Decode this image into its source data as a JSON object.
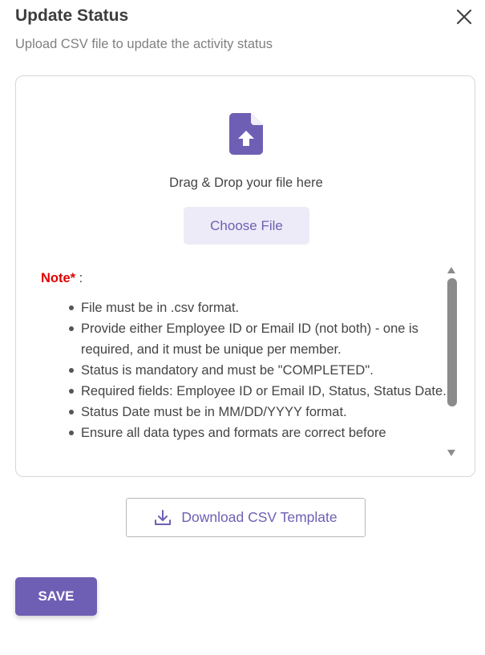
{
  "dialog": {
    "title": "Update Status",
    "subtitle": "Upload CSV file to update the activity status"
  },
  "dropzone": {
    "icon": "file-upload-icon",
    "prompt": "Drag & Drop your file here",
    "choose_label": "Choose File"
  },
  "notes": {
    "label": "Note*",
    "separator": " :",
    "items": [
      "File must be in .csv format.",
      "Provide either Employee ID or Email ID (not both) - one is required, and it must be unique per member.",
      "Status is mandatory and must be \"COMPLETED\".",
      "Required fields: Employee ID or Email ID, Status, Status Date.",
      "Status Date must be in MM/DD/YYYY format.",
      "Ensure all data types and formats are correct before"
    ]
  },
  "actions": {
    "download_label": "Download CSV Template",
    "save_label": "SAVE"
  },
  "colors": {
    "accent": "#6f5fb4",
    "accent_light": "#ecebf7",
    "note_red": "#e00000"
  }
}
